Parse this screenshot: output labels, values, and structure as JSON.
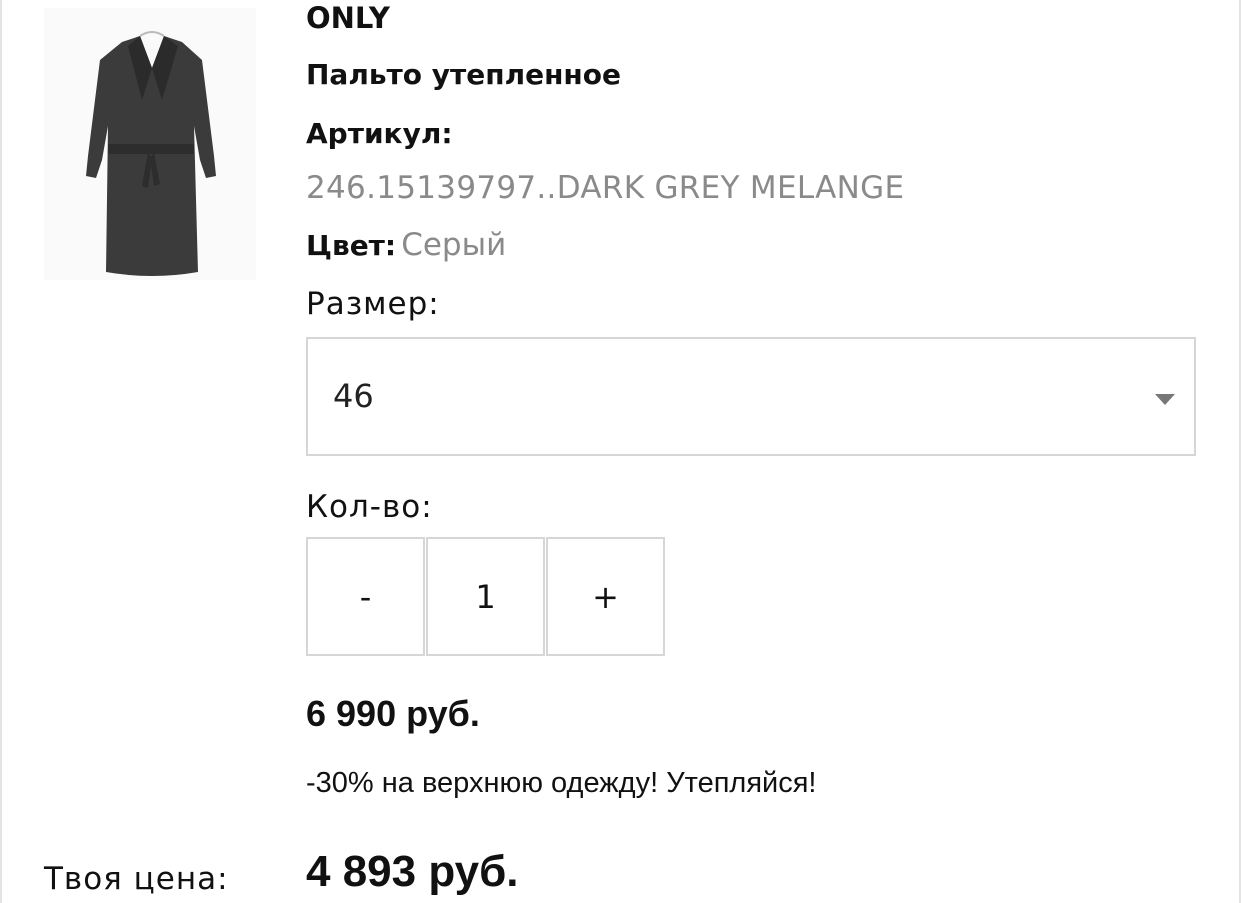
{
  "product": {
    "brand": "ONLY",
    "name": "Пальто утепленное",
    "sku_label": "Артикул:",
    "sku_value": "246.15139797..DARK GREY MELANGE",
    "color_label": "Цвет:",
    "color_value": "Серый",
    "image_icon": "coat-image"
  },
  "size": {
    "label": "Размер:",
    "selected": "46"
  },
  "quantity": {
    "label": "Кол-во:",
    "minus": "-",
    "value": "1",
    "plus": "+"
  },
  "pricing": {
    "old_price": "6 990 руб.",
    "promo": "-30% на верхнюю одежду! Утепляйся!",
    "your_price_label": "Твоя цена:",
    "your_price": "4 893 руб."
  },
  "colors": {
    "muted_text": "#8a8a8a",
    "border": "#d6d6d6"
  }
}
